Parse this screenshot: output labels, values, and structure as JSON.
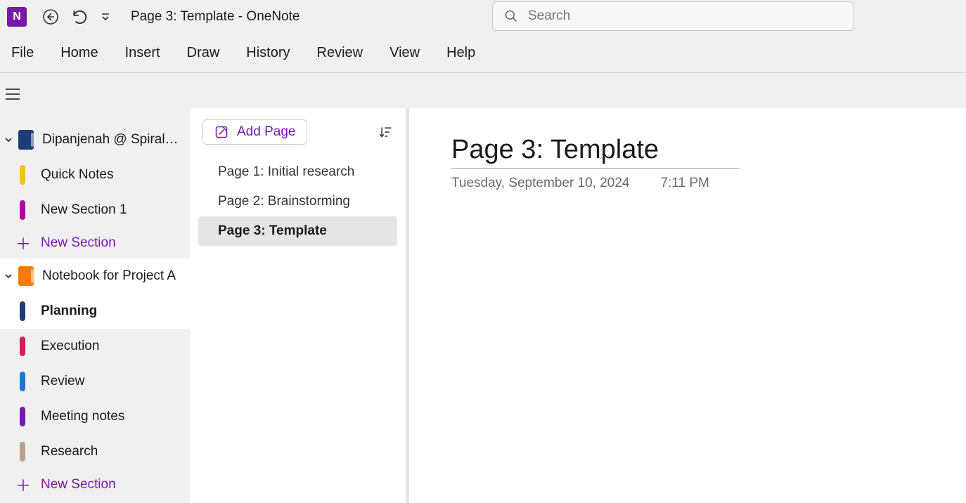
{
  "title_bar": {
    "document_title": "Page 3: Template  -  OneNote",
    "app_letter": "N"
  },
  "search": {
    "placeholder": "Search"
  },
  "ribbon": {
    "tabs": [
      "File",
      "Home",
      "Insert",
      "Draw",
      "History",
      "Review",
      "View",
      "Help"
    ]
  },
  "sidebar": {
    "notebooks": [
      {
        "name": "Dipanjenah @ Spiral…",
        "icon_color": "#1d3c78",
        "expanded": true,
        "selected": false,
        "sections": [
          {
            "label": "Quick Notes",
            "color": "#f0c419",
            "selected": false
          },
          {
            "label": "New Section 1",
            "color": "#b4009e",
            "selected": false
          }
        ],
        "new_section_label": "New Section"
      },
      {
        "name": "Notebook for Project A",
        "icon_color": "#f57c00",
        "expanded": true,
        "selected": true,
        "sections": [
          {
            "label": "Planning",
            "color": "#1d3c78",
            "selected": true
          },
          {
            "label": "Execution",
            "color": "#d81b60",
            "selected": false
          },
          {
            "label": "Review",
            "color": "#1976d2",
            "selected": false
          },
          {
            "label": "Meeting notes",
            "color": "#7719aa",
            "selected": false
          },
          {
            "label": "Research",
            "color": "#b9a189",
            "selected": false
          }
        ],
        "new_section_label": "New Section"
      }
    ]
  },
  "pages": {
    "add_page_label": "Add Page",
    "items": [
      {
        "title": "Page 1: Initial research",
        "selected": false
      },
      {
        "title": "Page 2: Brainstorming",
        "selected": false
      },
      {
        "title": "Page 3: Template",
        "selected": true
      }
    ]
  },
  "canvas": {
    "title": "Page 3: Template",
    "date": "Tuesday, September 10, 2024",
    "time": "7:11 PM"
  },
  "colors": {
    "accent": "#7719aa"
  }
}
